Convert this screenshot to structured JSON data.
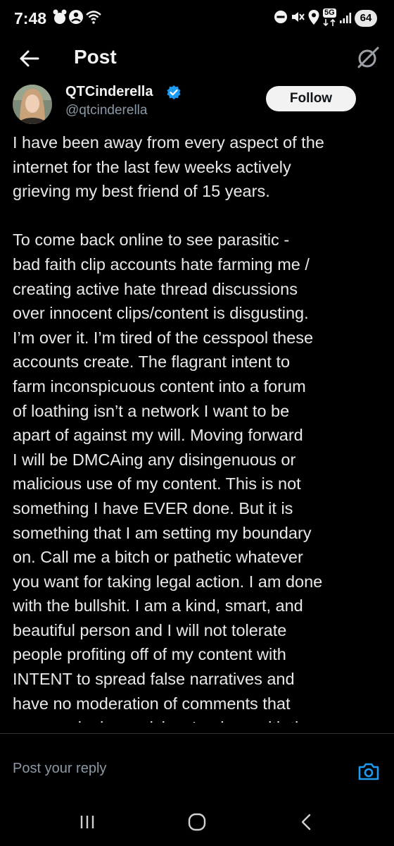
{
  "status_bar": {
    "time": "7:48",
    "battery_level": "64",
    "network": "5G",
    "icons": [
      "notification-icon",
      "face-icon",
      "wifi-icon",
      "dnd-icon",
      "mute-icon",
      "location-icon",
      "network-5g-icon",
      "signal-icon",
      "battery-icon"
    ]
  },
  "header": {
    "title": "Post",
    "back_icon": "arrow-left-icon",
    "action_icon": "grok-icon"
  },
  "author": {
    "display_name": "QTCinderella",
    "handle": "@qtcinderella",
    "verified": true,
    "follow_label": "Follow"
  },
  "post": {
    "paragraphs": [
      "I have been away from every aspect of the\ninternet for the last few weeks actively\ngrieving my best friend of 15 years.",
      "To come back online to see parasitic -\nbad faith clip accounts hate farming me /\ncreating active hate thread discussions\nover innocent clips/content is disgusting.\nI’m over it. I’m tired of the cesspool these\naccounts create. The flagrant intent to\nfarm inconspicuous content into a forum\nof loathing isn’t a network I want to be\napart of against my will. Moving forward\nI will be DMCAing any disingenuous or\nmalicious use of my content. This is not\nsomething I have EVER done. But it is\nsomething that I am setting my boundary\non. Call me a bitch or pathetic whatever\nyou want for taking legal action. I am done\nwith the bullshit. I am a kind, smart, and\nbeautiful person and I will not tolerate\npeople profiting off of my content with\nINTENT to spread false narratives and\nhave no moderation of comments that\nare genuinely repulsive. Im done with the"
    ]
  },
  "reply": {
    "placeholder": "Post your reply",
    "camera_icon": "camera-icon"
  },
  "nav": {
    "recents_icon": "recents-icon",
    "home_icon": "home-icon",
    "back_icon": "back-icon"
  },
  "colors": {
    "background": "#000000",
    "text": "#e7e9ea",
    "secondary_text": "#8b98a5",
    "accent": "#1d9bf0",
    "follow_bg": "#f2f2f2"
  }
}
